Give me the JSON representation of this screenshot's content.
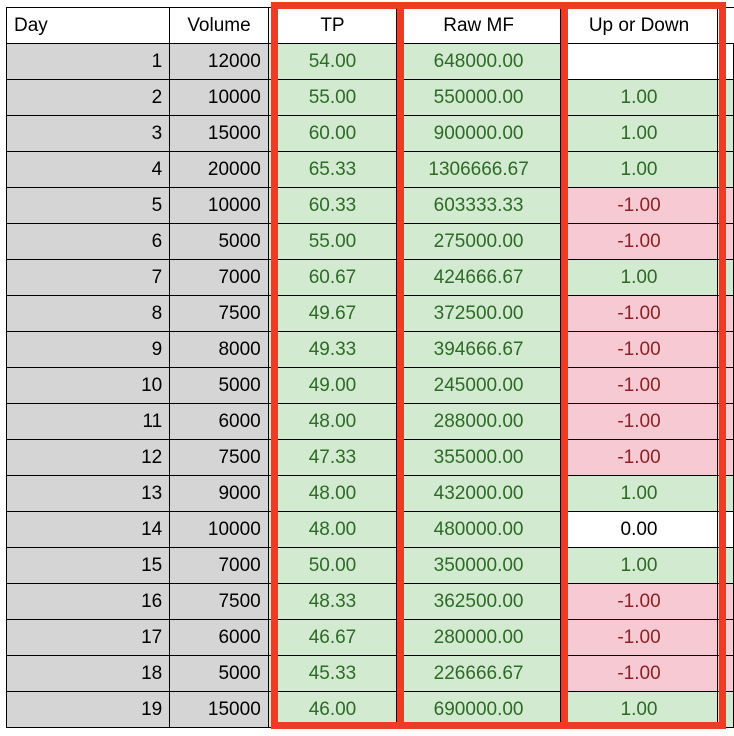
{
  "table": {
    "columns": [
      {
        "key": "day",
        "label": "Day",
        "align": "left",
        "fill": "gray"
      },
      {
        "key": "volume",
        "label": "Volume",
        "align": "center",
        "fill": "gray"
      },
      {
        "key": "tp",
        "label": "TP",
        "align": "center",
        "fill": "green"
      },
      {
        "key": "rawmf",
        "label": "Raw MF",
        "align": "center",
        "fill": "green"
      },
      {
        "key": "updown",
        "label": "Up or Down",
        "align": "center",
        "fill": "conditional"
      }
    ],
    "rows": [
      {
        "day": "1",
        "volume": "12000",
        "tp": "54.00",
        "rawmf": "648000.00",
        "updown": "",
        "updown_fill": "white"
      },
      {
        "day": "2",
        "volume": "10000",
        "tp": "55.00",
        "rawmf": "550000.00",
        "updown": "1.00",
        "updown_fill": "green"
      },
      {
        "day": "3",
        "volume": "15000",
        "tp": "60.00",
        "rawmf": "900000.00",
        "updown": "1.00",
        "updown_fill": "green"
      },
      {
        "day": "4",
        "volume": "20000",
        "tp": "65.33",
        "rawmf": "1306666.67",
        "updown": "1.00",
        "updown_fill": "green"
      },
      {
        "day": "5",
        "volume": "10000",
        "tp": "60.33",
        "rawmf": "603333.33",
        "updown": "-1.00",
        "updown_fill": "pink"
      },
      {
        "day": "6",
        "volume": "5000",
        "tp": "55.00",
        "rawmf": "275000.00",
        "updown": "-1.00",
        "updown_fill": "pink"
      },
      {
        "day": "7",
        "volume": "7000",
        "tp": "60.67",
        "rawmf": "424666.67",
        "updown": "1.00",
        "updown_fill": "green"
      },
      {
        "day": "8",
        "volume": "7500",
        "tp": "49.67",
        "rawmf": "372500.00",
        "updown": "-1.00",
        "updown_fill": "pink"
      },
      {
        "day": "9",
        "volume": "8000",
        "tp": "49.33",
        "rawmf": "394666.67",
        "updown": "-1.00",
        "updown_fill": "pink"
      },
      {
        "day": "10",
        "volume": "5000",
        "tp": "49.00",
        "rawmf": "245000.00",
        "updown": "-1.00",
        "updown_fill": "pink"
      },
      {
        "day": "11",
        "volume": "6000",
        "tp": "48.00",
        "rawmf": "288000.00",
        "updown": "-1.00",
        "updown_fill": "pink"
      },
      {
        "day": "12",
        "volume": "7500",
        "tp": "47.33",
        "rawmf": "355000.00",
        "updown": "-1.00",
        "updown_fill": "pink"
      },
      {
        "day": "13",
        "volume": "9000",
        "tp": "48.00",
        "rawmf": "432000.00",
        "updown": "1.00",
        "updown_fill": "green"
      },
      {
        "day": "14",
        "volume": "10000",
        "tp": "48.00",
        "rawmf": "480000.00",
        "updown": "0.00",
        "updown_fill": "white"
      },
      {
        "day": "15",
        "volume": "7000",
        "tp": "50.00",
        "rawmf": "350000.00",
        "updown": "1.00",
        "updown_fill": "green"
      },
      {
        "day": "16",
        "volume": "7500",
        "tp": "48.33",
        "rawmf": "362500.00",
        "updown": "-1.00",
        "updown_fill": "pink"
      },
      {
        "day": "17",
        "volume": "6000",
        "tp": "46.67",
        "rawmf": "280000.00",
        "updown": "-1.00",
        "updown_fill": "pink"
      },
      {
        "day": "18",
        "volume": "5000",
        "tp": "45.33",
        "rawmf": "226666.67",
        "updown": "-1.00",
        "updown_fill": "pink"
      },
      {
        "day": "19",
        "volume": "15000",
        "tp": "46.00",
        "rawmf": "690000.00",
        "updown": "1.00",
        "updown_fill": "green"
      }
    ]
  },
  "colors": {
    "highlight_border": "#ee3b24",
    "fill_gray": "#d5d5d5",
    "fill_green": "#d2ead0",
    "fill_pink": "#f7c9d2",
    "text_green": "#2d6a27",
    "text_red": "#8b2226",
    "text_black": "#000000",
    "grid_line": "#000000"
  },
  "highlight": {
    "label": "selected-range-outline",
    "covers_columns": [
      "TP",
      "Raw MF",
      "Up or Down"
    ]
  }
}
